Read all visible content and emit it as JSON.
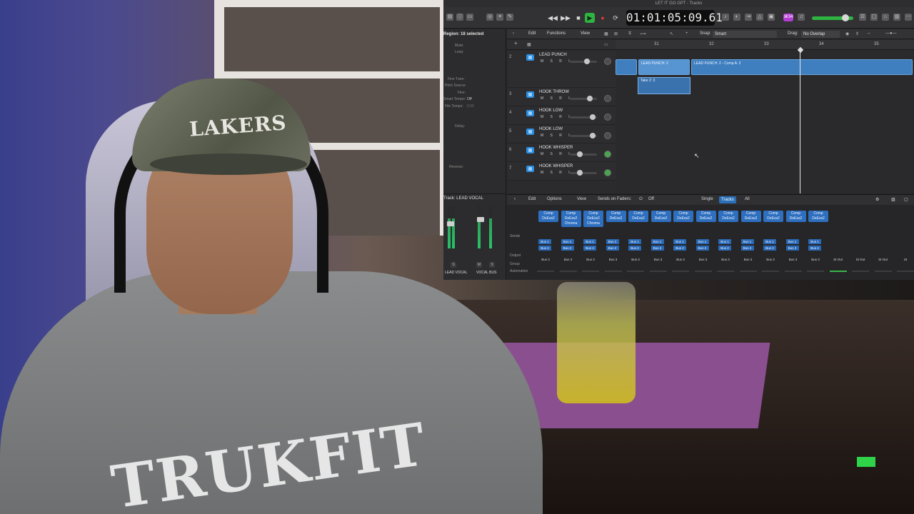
{
  "window": {
    "title": "LET IT GO GPT - Tracks"
  },
  "control_bar": {
    "lcd_time": "01:01:05:09.61",
    "cpu_badge": "⌘34",
    "accent": "#2fb442",
    "record_color": "#e23a3a"
  },
  "inspector": {
    "region_label": "Region: 18 selected",
    "rows": [
      {
        "label": "Mute:",
        "value": ""
      },
      {
        "label": "Loop:",
        "value": ""
      },
      {
        "label": "Fine Tune:",
        "value": ""
      },
      {
        "label": "Pitch Source:",
        "value": ""
      },
      {
        "label": "Flex:",
        "value": ""
      },
      {
        "label": "Smart Tempo:",
        "value": "Off"
      },
      {
        "label": "File Tempo:",
        "value": "0.00"
      },
      {
        "label": "Delay:",
        "value": ""
      },
      {
        "label": "Reverse:",
        "value": ""
      }
    ],
    "track_label": "Track: LEAD VOCAL",
    "strip_left_name": "LEAD VOCAL",
    "strip_right_name": "VOCAL BUS",
    "strip_left_btn": "S",
    "strip_right_btns": [
      "M",
      "S"
    ]
  },
  "tracks_toolbar": {
    "edit": "Edit",
    "functions": "Functions",
    "view": "View",
    "snap_label": "Snap:",
    "snap_value": "Smart",
    "drag_label": "Drag:",
    "drag_value": "No Overlap"
  },
  "ruler": {
    "bars": [
      "31",
      "32",
      "33",
      "34",
      "35"
    ]
  },
  "tracks": [
    {
      "num": "2",
      "name": "LEAD PUNCH",
      "buttons": "M S R I",
      "knob": 0.5,
      "pan_on": false
    },
    {
      "num": "3",
      "name": "HOOK THROW",
      "buttons": "M S R I",
      "knob": 0.6,
      "pan_on": false
    },
    {
      "num": "4",
      "name": "HOOK LOW",
      "buttons": "M S R I",
      "knob": 0.72,
      "pan_on": false
    },
    {
      "num": "5",
      "name": "HOOK LOW",
      "buttons": "M S R I",
      "knob": 0.72,
      "pan_on": false
    },
    {
      "num": "6",
      "name": "HOOK WHISPER",
      "buttons": "M S R I",
      "knob": 0.35,
      "pan_on": true
    },
    {
      "num": "7",
      "name": "HOOK WHISPER",
      "buttons": "M S R I",
      "knob": 0.35,
      "pan_on": true
    }
  ],
  "regions": {
    "a": "LEAD PUNCH: 2",
    "b": "LEAD PUNCH: 2 - Comp A: 2",
    "take": "Take 2: 3"
  },
  "mixer": {
    "edit": "Edit",
    "options": "Options",
    "view": "View",
    "sends_on_faders": "Sends on Faders:",
    "sends_value": "Off",
    "tab_single": "Single",
    "tab_tracks": "Tracks",
    "tab_all": "All",
    "side_labels": [
      "Sends",
      "Output",
      "Group",
      "Automation"
    ],
    "plugins": [
      {
        "a": "Comp",
        "b": "DeEss2",
        "c": ""
      },
      {
        "a": "Comp",
        "b": "DeEss2",
        "c": "Chroma"
      },
      {
        "a": "Comp",
        "b": "DeEss2",
        "c": "Chroma"
      },
      {
        "a": "Comp",
        "b": "DeEss2",
        "c": ""
      },
      {
        "a": "Comp",
        "b": "DeEss2",
        "c": ""
      },
      {
        "a": "Comp",
        "b": "DeEss2",
        "c": ""
      },
      {
        "a": "Comp",
        "b": "DeEss2",
        "c": ""
      },
      {
        "a": "Comp",
        "b": "DeEss2",
        "c": ""
      },
      {
        "a": "Comp",
        "b": "DeEss2",
        "c": ""
      },
      {
        "a": "Comp",
        "b": "DeEss2",
        "c": ""
      },
      {
        "a": "Comp",
        "b": "DeEss2",
        "c": ""
      },
      {
        "a": "Comp",
        "b": "DeEss2",
        "c": ""
      },
      {
        "a": "Comp",
        "b": "DeEss2",
        "c": ""
      }
    ],
    "send_1": "Bus 1",
    "send_2": "Bus 2",
    "outputs": [
      "Bus 3",
      "Bus 3",
      "Bus 3",
      "Bus 3",
      "Bus 3",
      "Bus 3",
      "Bus 3",
      "Bus 3",
      "Bus 3",
      "Bus 3",
      "Bus 3",
      "Bus 3",
      "Bus 3",
      "St Out",
      "St Out",
      "St Out",
      "St"
    ]
  },
  "webcam": {
    "cap_logo": "LAKERS",
    "shirt_text": "TRUKFIT"
  }
}
